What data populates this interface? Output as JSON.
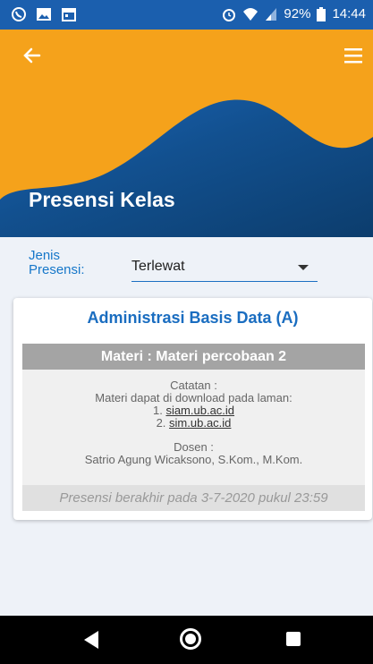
{
  "status_bar": {
    "battery": "92%",
    "time": "14:44",
    "icons": [
      "whatsapp-icon",
      "image-icon",
      "calendar-icon",
      "alarm-icon",
      "wifi-icon",
      "signal-icon",
      "battery-icon"
    ]
  },
  "header": {
    "title": "Presensi Kelas",
    "back_icon": "arrow-left-icon",
    "menu_icon": "hamburger-menu-icon",
    "colors": {
      "primary": "#1b5fae",
      "accent": "#f5a21b"
    }
  },
  "filter": {
    "label_line1": "Jenis",
    "label_line2": "Presensi:",
    "selected": "Terlewat"
  },
  "card": {
    "course": "Administrasi Basis Data (A)",
    "materi": "Materi : Materi percobaan 2",
    "catatan_label": "Catatan :",
    "catatan_text": "Materi dapat di download pada laman:",
    "links": [
      {
        "num": "1.",
        "url": "siam.ub.ac.id"
      },
      {
        "num": "2.",
        "url": "sim.ub.ac.id"
      }
    ],
    "dosen_label": "Dosen :",
    "dosen_name": "Satrio Agung Wicaksono, S.Kom., M.Kom.",
    "deadline": "Presensi berakhir pada 3-7-2020 pukul 23:59"
  },
  "nav": {
    "icons": [
      "nav-back-icon",
      "nav-home-icon",
      "nav-recents-icon"
    ]
  }
}
